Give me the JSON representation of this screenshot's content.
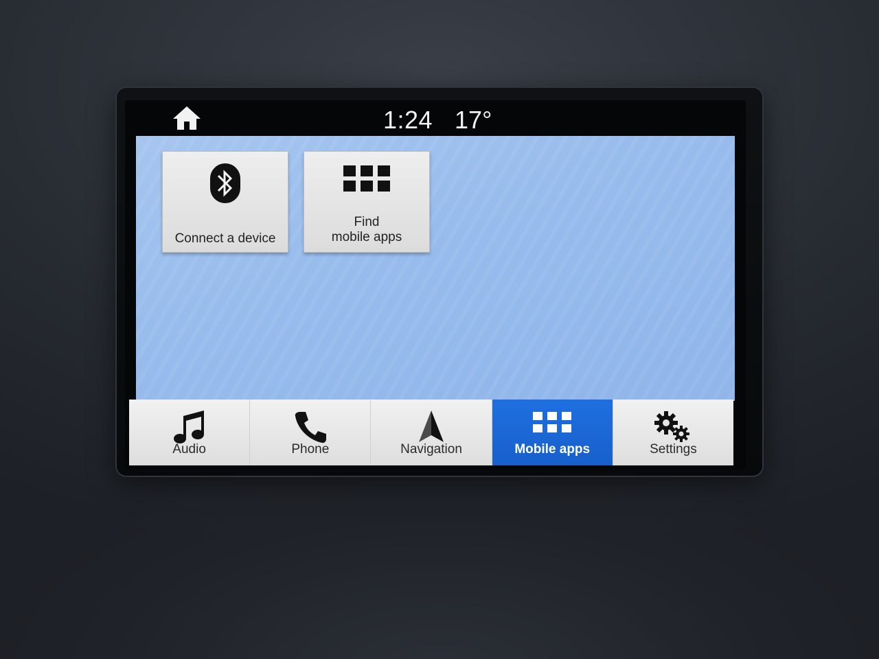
{
  "status": {
    "time": "1:24",
    "temperature": "17°",
    "home_icon": "home-icon"
  },
  "tiles": [
    {
      "icon": "bluetooth-icon",
      "label_lines": [
        "Connect a device"
      ]
    },
    {
      "icon": "apps-grid-icon",
      "label_lines": [
        "Find",
        "mobile apps"
      ]
    }
  ],
  "nav": {
    "items": [
      {
        "icon": "music-note-icon",
        "label": "Audio",
        "active": false
      },
      {
        "icon": "phone-icon",
        "label": "Phone",
        "active": false
      },
      {
        "icon": "navigation-arrow-icon",
        "label": "Navigation",
        "active": false
      },
      {
        "icon": "apps-grid-icon",
        "label": "Mobile apps",
        "active": true
      },
      {
        "icon": "gear-icon",
        "label": "Settings",
        "active": false
      }
    ]
  },
  "colors": {
    "accent": "#1f6fe0",
    "screen_background": "#98bcec",
    "tile_background": "#e6e6e6"
  }
}
